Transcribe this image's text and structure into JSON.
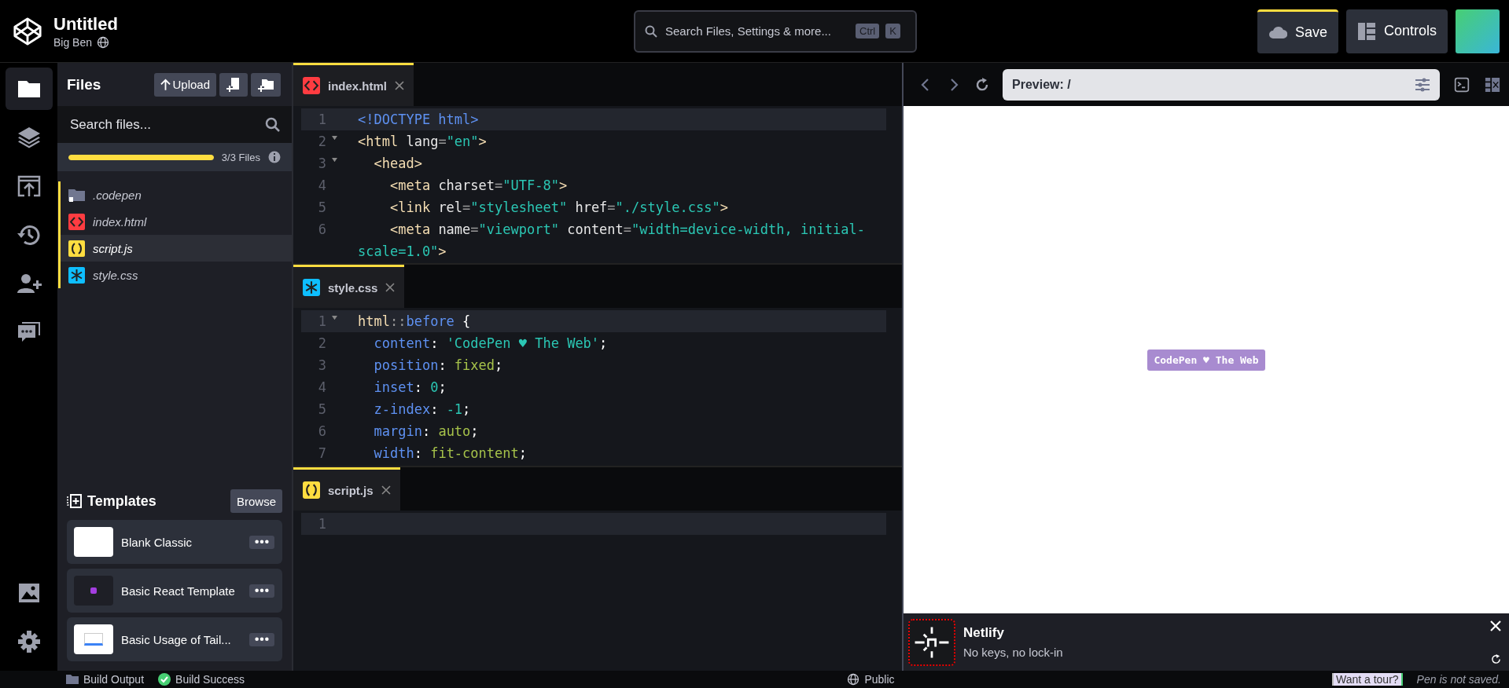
{
  "header": {
    "title": "Untitled",
    "owner": "Big Ben",
    "search": {
      "placeholder": "Search Files, Settings & more...",
      "keys": [
        "Ctrl",
        "K"
      ]
    },
    "buttons": [
      {
        "label": "Save",
        "kind": "save"
      },
      {
        "label": "Controls",
        "kind": "controls"
      }
    ]
  },
  "rail": {
    "top": [
      {
        "kind": "files",
        "selected": true
      },
      {
        "kind": "layers",
        "selected": false
      },
      {
        "kind": "deploy",
        "selected": false
      },
      {
        "kind": "history",
        "selected": false
      },
      {
        "kind": "collab",
        "selected": false
      },
      {
        "kind": "comments",
        "selected": false
      }
    ],
    "bottom": [
      {
        "kind": "assets",
        "selected": false
      },
      {
        "kind": "settings",
        "selected": false
      }
    ]
  },
  "files_panel": {
    "title": "Files",
    "upload": "Upload",
    "search": {
      "placeholder": "Search files..."
    },
    "usage": {
      "level": 1,
      "label": "3/3 Files"
    },
    "items": [
      {
        "name": ".codepen",
        "kind": "folder",
        "selected": false
      },
      {
        "name": "index.html",
        "kind": "html",
        "selected": false
      },
      {
        "name": "script.js",
        "kind": "js",
        "selected": true
      },
      {
        "name": "style.css",
        "kind": "css",
        "selected": false
      }
    ]
  },
  "templates": {
    "title": "Templates",
    "browse": "Browse",
    "items": [
      {
        "name": "Blank Classic",
        "kind": "blank"
      },
      {
        "name": "Basic React Template",
        "kind": "react"
      },
      {
        "name": "Basic Usage of Tail...",
        "kind": "form"
      }
    ]
  },
  "editors": [
    {
      "tab": "index.html",
      "kind": "html",
      "lines": [
        {
          "n": "1",
          "fold": false,
          "active": true,
          "tokens": [
            {
              "kind": "tag",
              "text": "<!DOCTYPE html>"
            }
          ]
        },
        {
          "n": "2",
          "fold": true,
          "active": false,
          "tokens": [
            {
              "kind": "el",
              "text": "<html"
            },
            {
              "kind": "attr",
              "text": " lang"
            },
            {
              "kind": "op",
              "text": "="
            },
            {
              "kind": "str",
              "text": "\"en\""
            },
            {
              "kind": "el",
              "text": ">"
            }
          ]
        },
        {
          "n": "3",
          "fold": true,
          "active": false,
          "tokens": [
            {
              "kind": "el",
              "text": "  <head>"
            }
          ]
        },
        {
          "n": "4",
          "fold": false,
          "active": false,
          "tokens": [
            {
              "kind": "el",
              "text": "    <meta"
            },
            {
              "kind": "attr",
              "text": " charset"
            },
            {
              "kind": "op",
              "text": "="
            },
            {
              "kind": "str",
              "text": "\"UTF-8\""
            },
            {
              "kind": "el",
              "text": ">"
            }
          ]
        },
        {
          "n": "5",
          "fold": false,
          "active": false,
          "tokens": [
            {
              "kind": "el",
              "text": "    <link"
            },
            {
              "kind": "attr",
              "text": " rel"
            },
            {
              "kind": "op",
              "text": "="
            },
            {
              "kind": "str",
              "text": "\"stylesheet\""
            },
            {
              "kind": "attr",
              "text": " href"
            },
            {
              "kind": "op",
              "text": "="
            },
            {
              "kind": "str",
              "text": "\"./style.css\""
            },
            {
              "kind": "el",
              "text": ">"
            }
          ]
        },
        {
          "n": "6",
          "fold": false,
          "active": false,
          "tokens": [
            {
              "kind": "el",
              "text": "    <meta"
            },
            {
              "kind": "attr",
              "text": " name"
            },
            {
              "kind": "op",
              "text": "="
            },
            {
              "kind": "str",
              "text": "\"viewport\""
            },
            {
              "kind": "attr",
              "text": " content"
            },
            {
              "kind": "op",
              "text": "="
            },
            {
              "kind": "str",
              "text": "\"width=device-width, initial-scale=1.0\""
            },
            {
              "kind": "el",
              "text": ">"
            }
          ]
        }
      ]
    },
    {
      "tab": "style.css",
      "kind": "css",
      "lines": [
        {
          "n": "1",
          "fold": true,
          "active": true,
          "tokens": [
            {
              "kind": "el",
              "text": "html"
            },
            {
              "kind": "op",
              "text": "::"
            },
            {
              "kind": "tag",
              "text": "before"
            },
            {
              "kind": "plain",
              "text": " {"
            }
          ]
        },
        {
          "n": "2",
          "fold": false,
          "active": false,
          "tokens": [
            {
              "kind": "prop",
              "text": "  content"
            },
            {
              "kind": "plain",
              "text": ": "
            },
            {
              "kind": "str",
              "text": "'CodePen ♥ The Web'"
            },
            {
              "kind": "plain",
              "text": ";"
            }
          ]
        },
        {
          "n": "3",
          "fold": false,
          "active": false,
          "tokens": [
            {
              "kind": "prop",
              "text": "  position"
            },
            {
              "kind": "plain",
              "text": ": "
            },
            {
              "kind": "val",
              "text": "fixed"
            },
            {
              "kind": "plain",
              "text": ";"
            }
          ]
        },
        {
          "n": "4",
          "fold": false,
          "active": false,
          "tokens": [
            {
              "kind": "prop",
              "text": "  inset"
            },
            {
              "kind": "plain",
              "text": ": "
            },
            {
              "kind": "str",
              "text": "0"
            },
            {
              "kind": "plain",
              "text": ";"
            }
          ]
        },
        {
          "n": "5",
          "fold": false,
          "active": false,
          "tokens": [
            {
              "kind": "prop",
              "text": "  z-index"
            },
            {
              "kind": "plain",
              "text": ": "
            },
            {
              "kind": "str",
              "text": "-1"
            },
            {
              "kind": "plain",
              "text": ";"
            }
          ]
        },
        {
          "n": "6",
          "fold": false,
          "active": false,
          "tokens": [
            {
              "kind": "prop",
              "text": "  margin"
            },
            {
              "kind": "plain",
              "text": ": "
            },
            {
              "kind": "val",
              "text": "auto"
            },
            {
              "kind": "plain",
              "text": ";"
            }
          ]
        },
        {
          "n": "7",
          "fold": false,
          "active": false,
          "tokens": [
            {
              "kind": "prop",
              "text": "  width"
            },
            {
              "kind": "plain",
              "text": ": "
            },
            {
              "kind": "val",
              "text": "fit-content"
            },
            {
              "kind": "plain",
              "text": ";"
            }
          ]
        }
      ]
    },
    {
      "tab": "script.js",
      "kind": "js",
      "lines": [
        {
          "n": "1",
          "fold": false,
          "active": true
        }
      ]
    }
  ],
  "preview": {
    "url": "Preview: /",
    "badge": "CodePen ♥ The Web"
  },
  "toast": {
    "title": "Netlify",
    "text": "No keys, no lock-in"
  },
  "status": {
    "build_output": "Build Output",
    "build": "Build Success",
    "visibility": "Public",
    "tour": "Want a tour?",
    "saved": "Pen is not saved."
  }
}
